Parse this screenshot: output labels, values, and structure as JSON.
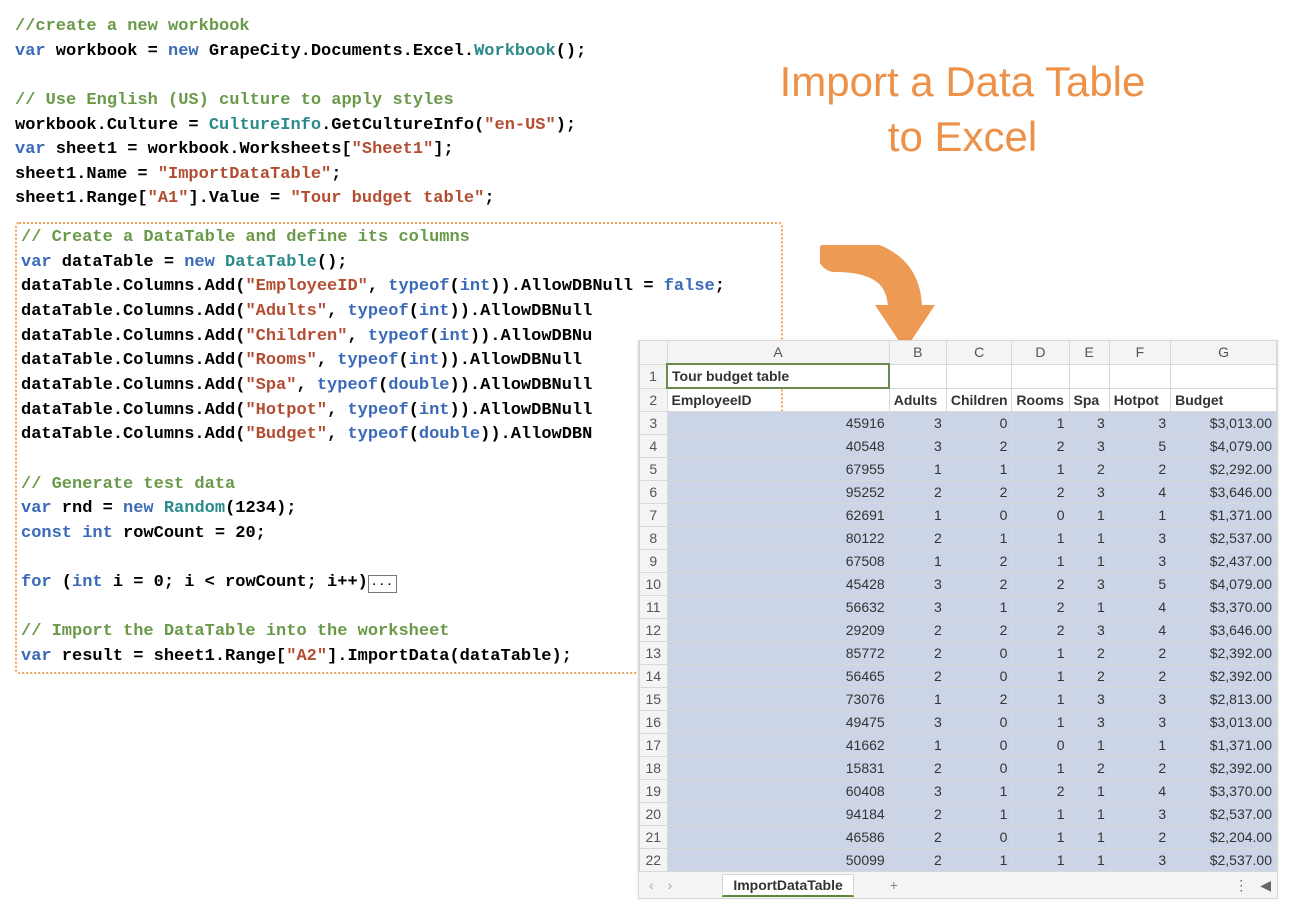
{
  "code_top": {
    "c1": "//create a new workbook",
    "l1a": "var",
    "l1b": " workbook = ",
    "l1c": "new",
    "l1d": " GrapeCity.Documents.Excel.",
    "l1e": "Workbook",
    "l1f": "();",
    "c2": "// Use English (US) culture to apply styles",
    "l2a": "workbook.Culture = ",
    "l2b": "CultureInfo",
    "l2c": ".GetCultureInfo(",
    "l2d": "\"en-US\"",
    "l2e": ");",
    "l3a": "var",
    "l3b": " sheet1 = workbook.Worksheets[",
    "l3c": "\"Sheet1\"",
    "l3d": "];",
    "l4a": "sheet1.Name = ",
    "l4b": "\"ImportDataTable\"",
    "l4c": ";",
    "l5a": "sheet1.Range[",
    "l5b": "\"A1\"",
    "l5c": "].Value = ",
    "l5d": "\"Tour budget table\"",
    "l5e": ";"
  },
  "code_box": {
    "c1": "// Create a DataTable and define its columns",
    "l1a": "var",
    "l1b": " dataTable = ",
    "l1c": "new",
    "l1d": " ",
    "l1e": "DataTable",
    "l1f": "();",
    "d_pre": "dataTable.Columns.Add(",
    "d_ty": "typeof",
    "d_eq": ").AllowDBNull = ",
    "d_false": "false",
    "d_sc": ";",
    "col1": "\"EmployeeID\"",
    "t1": "int",
    "col2": "\"Adults\"",
    "t2": "int",
    "tail2": ").AllowDBNull",
    "col3": "\"Children\"",
    "t3": "int",
    "tail3": ").AllowDBNu",
    "col4": "\"Rooms\"",
    "t4": "int",
    "tail4": ").AllowDBNull",
    "col5": "\"Spa\"",
    "t5": "double",
    "tail5": ").AllowDBNull",
    "col6": "\"Hotpot\"",
    "t6": "int",
    "tail6": ").AllowDBNull",
    "col7": "\"Budget\"",
    "t7": "double",
    "tail7": ").AllowDBN",
    "c2": "// Generate test data",
    "g1a": "var",
    "g1b": " rnd = ",
    "g1c": "new",
    "g1d": " ",
    "g1e": "Random",
    "g1f": "(1234);",
    "g2a": "const int",
    "g2b": " rowCount = 20;",
    "f1a": "for",
    "f1b": " (",
    "f1c": "int",
    "f1d": " i = 0; i < rowCount; i++)",
    "f1e": "...",
    "c3": "// Import the DataTable into the worksheet",
    "r1a": "var",
    "r1b": " result = sheet1.Range[",
    "r1c": "\"A2\"",
    "r1d": "].ImportData(dataTable);"
  },
  "heading_line1": "Import a Data Table",
  "heading_line2": "to Excel",
  "sheet": {
    "col_letters": [
      "A",
      "B",
      "C",
      "D",
      "E",
      "F",
      "G"
    ],
    "title": "Tour budget table",
    "headers": [
      "EmployeeID",
      "Adults",
      "Children",
      "Rooms",
      "Spa",
      "Hotpot",
      "Budget"
    ],
    "rows": [
      {
        "n": 3,
        "v": [
          "45916",
          "3",
          "0",
          "1",
          "3",
          "3",
          "$3,013.00"
        ]
      },
      {
        "n": 4,
        "v": [
          "40548",
          "3",
          "2",
          "2",
          "3",
          "5",
          "$4,079.00"
        ]
      },
      {
        "n": 5,
        "v": [
          "67955",
          "1",
          "1",
          "1",
          "2",
          "2",
          "$2,292.00"
        ]
      },
      {
        "n": 6,
        "v": [
          "95252",
          "2",
          "2",
          "2",
          "3",
          "4",
          "$3,646.00"
        ]
      },
      {
        "n": 7,
        "v": [
          "62691",
          "1",
          "0",
          "0",
          "1",
          "1",
          "$1,371.00"
        ]
      },
      {
        "n": 8,
        "v": [
          "80122",
          "2",
          "1",
          "1",
          "1",
          "3",
          "$2,537.00"
        ]
      },
      {
        "n": 9,
        "v": [
          "67508",
          "1",
          "2",
          "1",
          "1",
          "3",
          "$2,437.00"
        ]
      },
      {
        "n": 10,
        "v": [
          "45428",
          "3",
          "2",
          "2",
          "3",
          "5",
          "$4,079.00"
        ]
      },
      {
        "n": 11,
        "v": [
          "56632",
          "3",
          "1",
          "2",
          "1",
          "4",
          "$3,370.00"
        ]
      },
      {
        "n": 12,
        "v": [
          "29209",
          "2",
          "2",
          "2",
          "3",
          "4",
          "$3,646.00"
        ]
      },
      {
        "n": 13,
        "v": [
          "85772",
          "2",
          "0",
          "1",
          "2",
          "2",
          "$2,392.00"
        ]
      },
      {
        "n": 14,
        "v": [
          "56465",
          "2",
          "0",
          "1",
          "2",
          "2",
          "$2,392.00"
        ]
      },
      {
        "n": 15,
        "v": [
          "73076",
          "1",
          "2",
          "1",
          "3",
          "3",
          "$2,813.00"
        ]
      },
      {
        "n": 16,
        "v": [
          "49475",
          "3",
          "0",
          "1",
          "3",
          "3",
          "$3,013.00"
        ]
      },
      {
        "n": 17,
        "v": [
          "41662",
          "1",
          "0",
          "0",
          "1",
          "1",
          "$1,371.00"
        ]
      },
      {
        "n": 18,
        "v": [
          "15831",
          "2",
          "0",
          "1",
          "2",
          "2",
          "$2,392.00"
        ]
      },
      {
        "n": 19,
        "v": [
          "60408",
          "3",
          "1",
          "2",
          "1",
          "4",
          "$3,370.00"
        ]
      },
      {
        "n": 20,
        "v": [
          "94184",
          "2",
          "1",
          "1",
          "1",
          "3",
          "$2,537.00"
        ]
      },
      {
        "n": 21,
        "v": [
          "46586",
          "2",
          "0",
          "1",
          "1",
          "2",
          "$2,204.00"
        ]
      },
      {
        "n": 22,
        "v": [
          "50099",
          "2",
          "1",
          "1",
          "1",
          "3",
          "$2,537.00"
        ]
      }
    ],
    "tab_name": "ImportDataTable",
    "nav_prev": "‹",
    "nav_next": "›",
    "plus": "+",
    "dots": "⋮",
    "scroll": "◀"
  }
}
